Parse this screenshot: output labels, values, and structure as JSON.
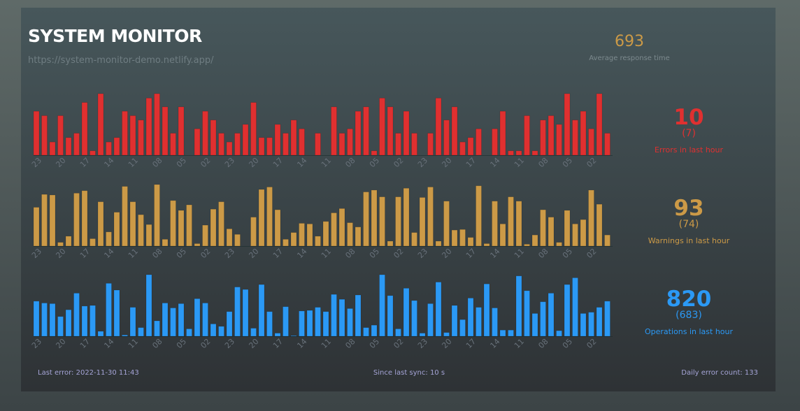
{
  "header": {
    "title": "SYSTEM MONITOR",
    "url": "https://system-monitor-demo.netlify.app/"
  },
  "average": {
    "value": "693",
    "label": "Average response time"
  },
  "stats": [
    {
      "value": "10",
      "previous": "(7)",
      "label": "Errors in last hour",
      "color": "#e03030"
    },
    {
      "value": "93",
      "previous": "(74)",
      "label": "Warnings in last hour",
      "color": "#cc9a47"
    },
    {
      "value": "820",
      "previous": "(683)",
      "label": "Operations in last hour",
      "color": "#2b99f5"
    }
  ],
  "footer": {
    "last_error": "Last error: 2022-11-30 11:43",
    "since_sync": "Since last sync: 10 s",
    "daily_errors": "Daily error count: 133"
  },
  "chart_data": [
    {
      "type": "bar",
      "color": "#e03030",
      "ylim": [
        0,
        14
      ],
      "tick_labels": [
        "23",
        "20",
        "17",
        "14",
        "11",
        "08",
        "05",
        "02",
        "23",
        "20",
        "17",
        "14",
        "11",
        "08",
        "05",
        "02",
        "23",
        "20",
        "17",
        "14",
        "11",
        "08",
        "05",
        "02"
      ],
      "values": [
        10,
        9,
        3,
        9,
        4,
        5,
        12,
        1,
        14,
        3,
        4,
        10,
        9,
        8,
        13,
        14,
        11,
        5,
        11,
        0,
        6,
        10,
        8,
        5,
        3,
        5,
        7,
        12,
        4,
        4,
        7,
        5,
        8,
        6,
        0,
        5,
        0,
        11,
        5,
        6,
        10,
        11,
        1,
        13,
        11,
        5,
        10,
        5,
        0,
        5,
        13,
        8,
        11,
        3,
        4,
        6,
        0,
        6,
        10,
        1,
        1,
        9,
        1,
        8,
        9,
        7,
        14,
        8,
        10,
        6,
        14,
        5
      ]
    },
    {
      "type": "bar",
      "color": "#cc9a47",
      "ylim": [
        0,
        100
      ],
      "tick_labels": [
        "23",
        "20",
        "17",
        "14",
        "11",
        "08",
        "05",
        "02",
        "23",
        "20",
        "17",
        "14",
        "11",
        "08",
        "05",
        "02",
        "23",
        "20",
        "17",
        "14",
        "11",
        "08",
        "05",
        "02"
      ],
      "values": [
        63,
        84,
        83,
        6,
        16,
        86,
        90,
        12,
        72,
        23,
        55,
        97,
        72,
        51,
        35,
        100,
        11,
        74,
        58,
        67,
        4,
        34,
        60,
        72,
        28,
        19,
        0,
        47,
        92,
        96,
        59,
        11,
        22,
        37,
        36,
        16,
        40,
        54,
        61,
        38,
        31,
        88,
        91,
        80,
        8,
        80,
        94,
        22,
        79,
        96,
        8,
        73,
        26,
        27,
        14,
        98,
        4,
        73,
        36,
        80,
        73,
        3,
        18,
        59,
        47,
        6,
        58,
        36,
        43,
        91,
        68,
        18
      ]
    },
    {
      "type": "bar",
      "color": "#2b99f5",
      "ylim": [
        0,
        100
      ],
      "tick_labels": [
        "23",
        "20",
        "17",
        "14",
        "11",
        "08",
        "05",
        "02",
        "23",
        "20",
        "17",
        "14",
        "11",
        "08",
        "05",
        "02",
        "23",
        "20",
        "17",
        "14",
        "11",
        "08",
        "05",
        "02"
      ],
      "values": [
        57,
        54,
        53,
        32,
        43,
        70,
        49,
        50,
        8,
        86,
        75,
        2,
        47,
        14,
        100,
        25,
        54,
        46,
        53,
        12,
        61,
        54,
        20,
        16,
        40,
        80,
        76,
        13,
        84,
        40,
        5,
        48,
        1,
        41,
        42,
        47,
        40,
        68,
        60,
        45,
        67,
        14,
        18,
        100,
        66,
        12,
        78,
        58,
        5,
        53,
        88,
        6,
        50,
        27,
        62,
        47,
        85,
        46,
        10,
        10,
        98,
        74,
        37,
        56,
        70,
        9,
        84,
        95,
        37,
        39,
        47,
        57
      ]
    }
  ]
}
